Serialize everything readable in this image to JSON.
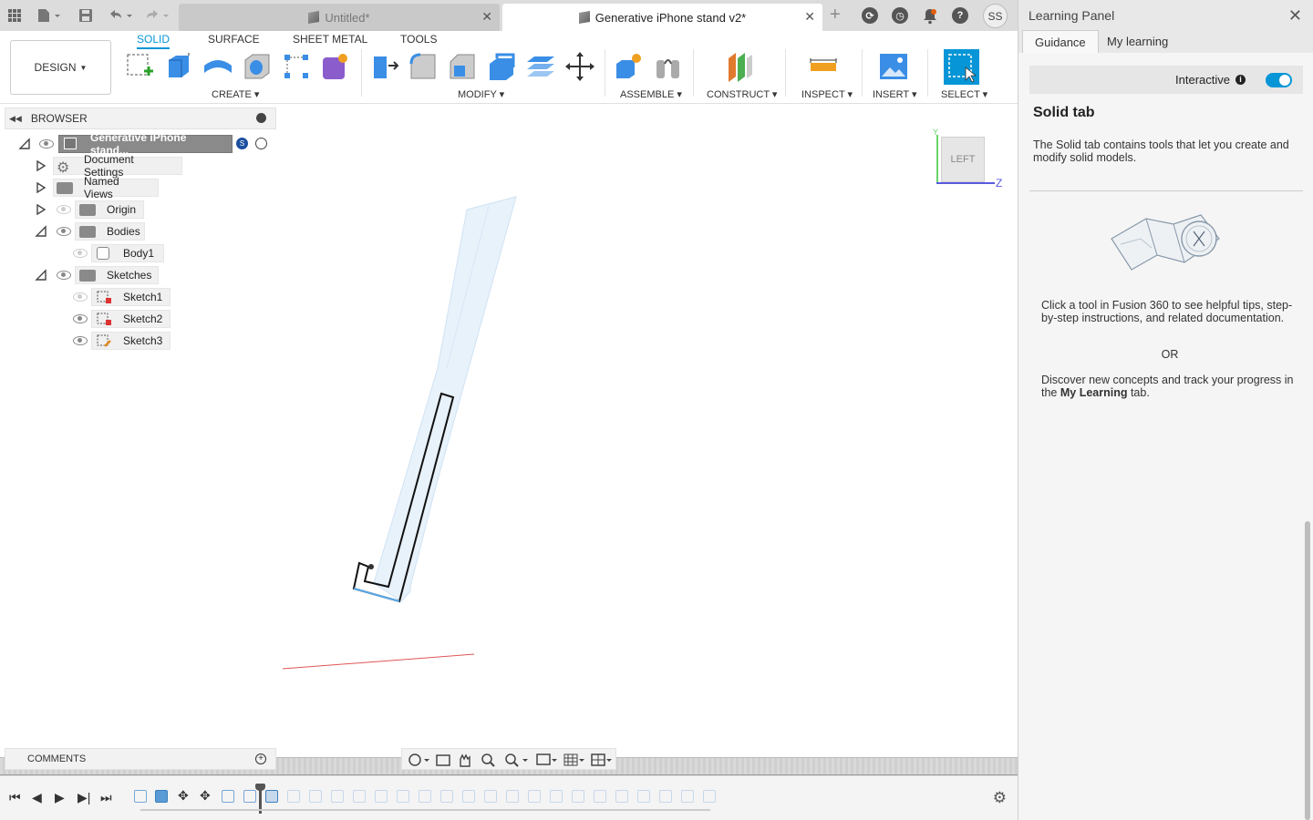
{
  "titlebar": {
    "tabs": [
      {
        "label": "Untitled*",
        "active": false
      },
      {
        "label": "Generative iPhone stand v2*",
        "active": true
      }
    ],
    "user_initials": "SS"
  },
  "ribbon": {
    "workspace": "DESIGN",
    "tabs": [
      "SOLID",
      "SURFACE",
      "SHEET METAL",
      "TOOLS"
    ],
    "active_tab": "SOLID",
    "groups": [
      "CREATE",
      "MODIFY",
      "ASSEMBLE",
      "CONSTRUCT",
      "INSPECT",
      "INSERT",
      "SELECT"
    ]
  },
  "browser": {
    "title": "BROWSER",
    "root": "Generative iPhone stand...",
    "items": [
      {
        "label": "Document Settings"
      },
      {
        "label": "Named Views"
      },
      {
        "label": "Origin"
      },
      {
        "label": "Bodies"
      },
      {
        "label": "Body1"
      },
      {
        "label": "Sketches"
      },
      {
        "label": "Sketch1"
      },
      {
        "label": "Sketch2"
      },
      {
        "label": "Sketch3"
      }
    ]
  },
  "viewcube": {
    "face": "LEFT",
    "axis_y": "Y",
    "axis_z": "Z"
  },
  "comments": {
    "label": "COMMENTS"
  },
  "learning_panel": {
    "title": "Learning Panel",
    "tabs": [
      "Guidance",
      "My learning"
    ],
    "active_tab": "Guidance",
    "interactive_label": "Interactive",
    "interactive_on": true,
    "section_title": "Solid tab",
    "section_desc": "The Solid tab contains tools that let you create and modify solid models.",
    "tip": "Click a tool in Fusion 360 to see helpful tips, step-by-step instructions, and related documentation.",
    "or": "OR",
    "discover_prefix": "Discover new concepts and track your progress in the ",
    "discover_bold": "My Learning",
    "discover_suffix": " tab."
  },
  "colors": {
    "accent": "#0696d7",
    "sketch_fill": "#e8f2fb",
    "ground": "#d4d4d4"
  }
}
